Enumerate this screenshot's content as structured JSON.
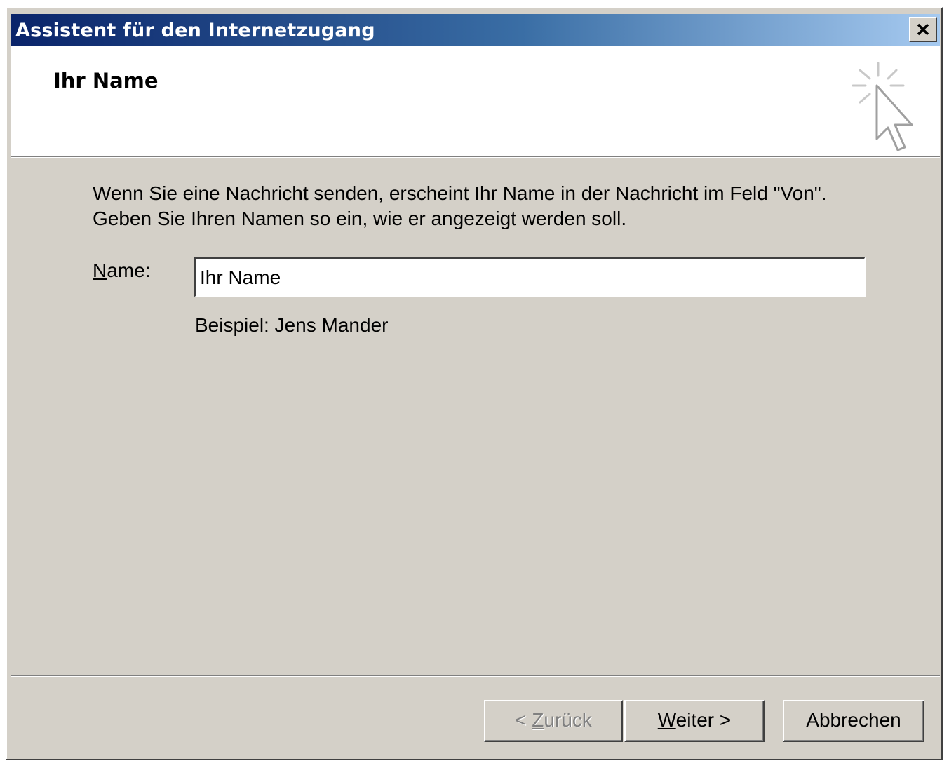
{
  "window": {
    "title": "Assistent für den Internetzugang"
  },
  "header": {
    "title": "Ihr Name",
    "icon": "wizard-cursor-sparkle-icon"
  },
  "content": {
    "description_line1": "Wenn Sie eine Nachricht senden, erscheint Ihr Name in der Nachricht im Feld \"Von\".",
    "description_line2": "Geben Sie Ihren Namen so ein, wie er angezeigt werden soll.",
    "name_label_mnemonic": "N",
    "name_label_rest": "ame:",
    "name_value": "Ihr Name",
    "example": "Beispiel: Jens Mander"
  },
  "buttons": {
    "back_prefix": "< ",
    "back_mnemonic": "Z",
    "back_rest": "urück",
    "back_disabled": true,
    "next_mnemonic": "W",
    "next_rest": "eiter >",
    "cancel_label": "Abbrechen"
  },
  "colors": {
    "face": "#d4d0c8",
    "title_start": "#0a246a",
    "title_end": "#a6caf0",
    "disabled_text": "#808080"
  }
}
